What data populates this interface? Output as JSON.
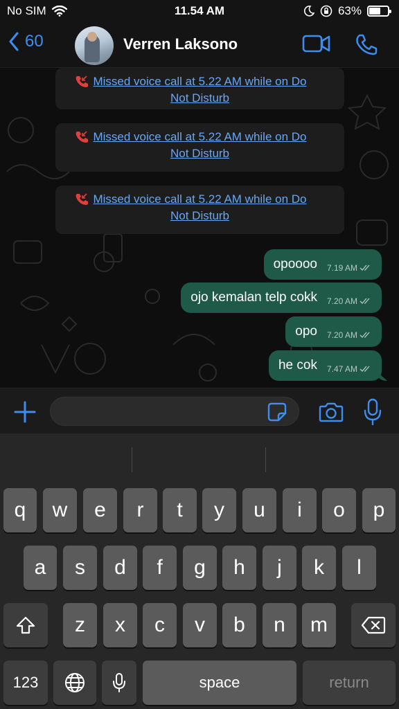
{
  "status_bar": {
    "carrier": "No SIM",
    "time": "11.54 AM",
    "battery_percent": "63%",
    "battery_level": 0.63
  },
  "header": {
    "back_count": "60",
    "contact_name": "Verren Laksono"
  },
  "system_messages": [
    {
      "text": "Missed voice call at 5.22 AM while on Do Not Disturb"
    },
    {
      "text": "Missed voice call at 5.22 AM while on Do Not Disturb"
    },
    {
      "text": "Missed voice call at 5.22 AM while on Do Not Disturb"
    }
  ],
  "messages": [
    {
      "text": "opoooo",
      "time": "7.19 AM"
    },
    {
      "text": "ojo kemalan telp cokk",
      "time": "7.20 AM"
    },
    {
      "text": "opo",
      "time": "7.20 AM"
    },
    {
      "text": "he cok",
      "time": "7.47 AM"
    }
  ],
  "input": {
    "value": ""
  },
  "keyboard": {
    "row1": [
      "q",
      "w",
      "e",
      "r",
      "t",
      "y",
      "u",
      "i",
      "o",
      "p"
    ],
    "row2": [
      "a",
      "s",
      "d",
      "f",
      "g",
      "h",
      "j",
      "k",
      "l"
    ],
    "row3": [
      "z",
      "x",
      "c",
      "v",
      "b",
      "n",
      "m"
    ],
    "numbers_key": "123",
    "space_key": "space",
    "return_key": "return"
  },
  "colors": {
    "accent": "#3d8ef0",
    "outgoing_bubble": "#1f5a48",
    "missed_call_icon": "#e0403a",
    "link": "#6aa6f5"
  },
  "icons": [
    "wifi-icon",
    "moon-icon",
    "rotation-lock-icon",
    "battery-icon",
    "back-chevron-icon",
    "video-call-icon",
    "voice-call-icon",
    "missed-call-icon",
    "double-check-icon",
    "plus-icon",
    "sticker-icon",
    "camera-icon",
    "microphone-icon",
    "shift-icon",
    "backspace-icon",
    "globe-icon",
    "keyboard-mic-icon"
  ]
}
